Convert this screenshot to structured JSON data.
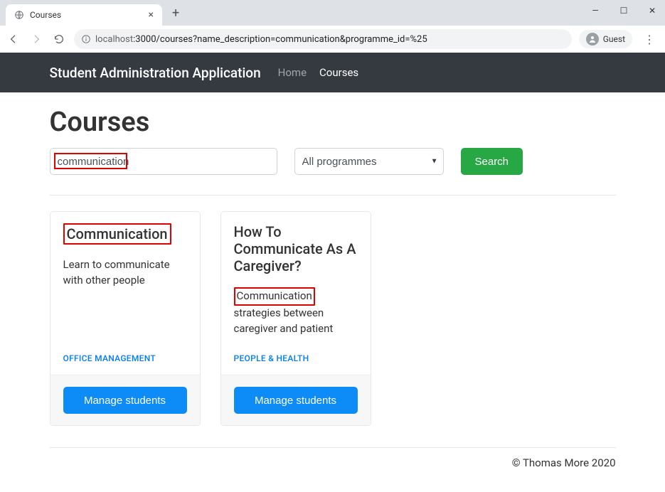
{
  "browser": {
    "tab_title": "Courses",
    "url_host": "localhost",
    "url_path": ":3000/courses?name_description=communication&programme_id=%25",
    "guest_label": "Guest"
  },
  "navbar": {
    "brand": "Student Administration Application",
    "links": [
      {
        "label": "Home",
        "active": false
      },
      {
        "label": "Courses",
        "active": true
      }
    ]
  },
  "page": {
    "title": "Courses",
    "search_value": "communication",
    "programme_select": "All programmes",
    "search_button": "Search"
  },
  "cards": [
    {
      "title": "Communication",
      "description_pre": "",
      "description_hl": "",
      "description_post": "Learn to communicate with other people",
      "tag": "OFFICE MANAGEMENT",
      "manage_label": "Manage students",
      "title_highlight": true
    },
    {
      "title": "How To Communicate As A Caregiver?",
      "description_pre": "",
      "description_hl": "Communication",
      "description_post": " strategies between caregiver and patient",
      "tag": "PEOPLE & HEALTH",
      "manage_label": "Manage students",
      "title_highlight": false
    }
  ],
  "footer": "© Thomas More 2020"
}
